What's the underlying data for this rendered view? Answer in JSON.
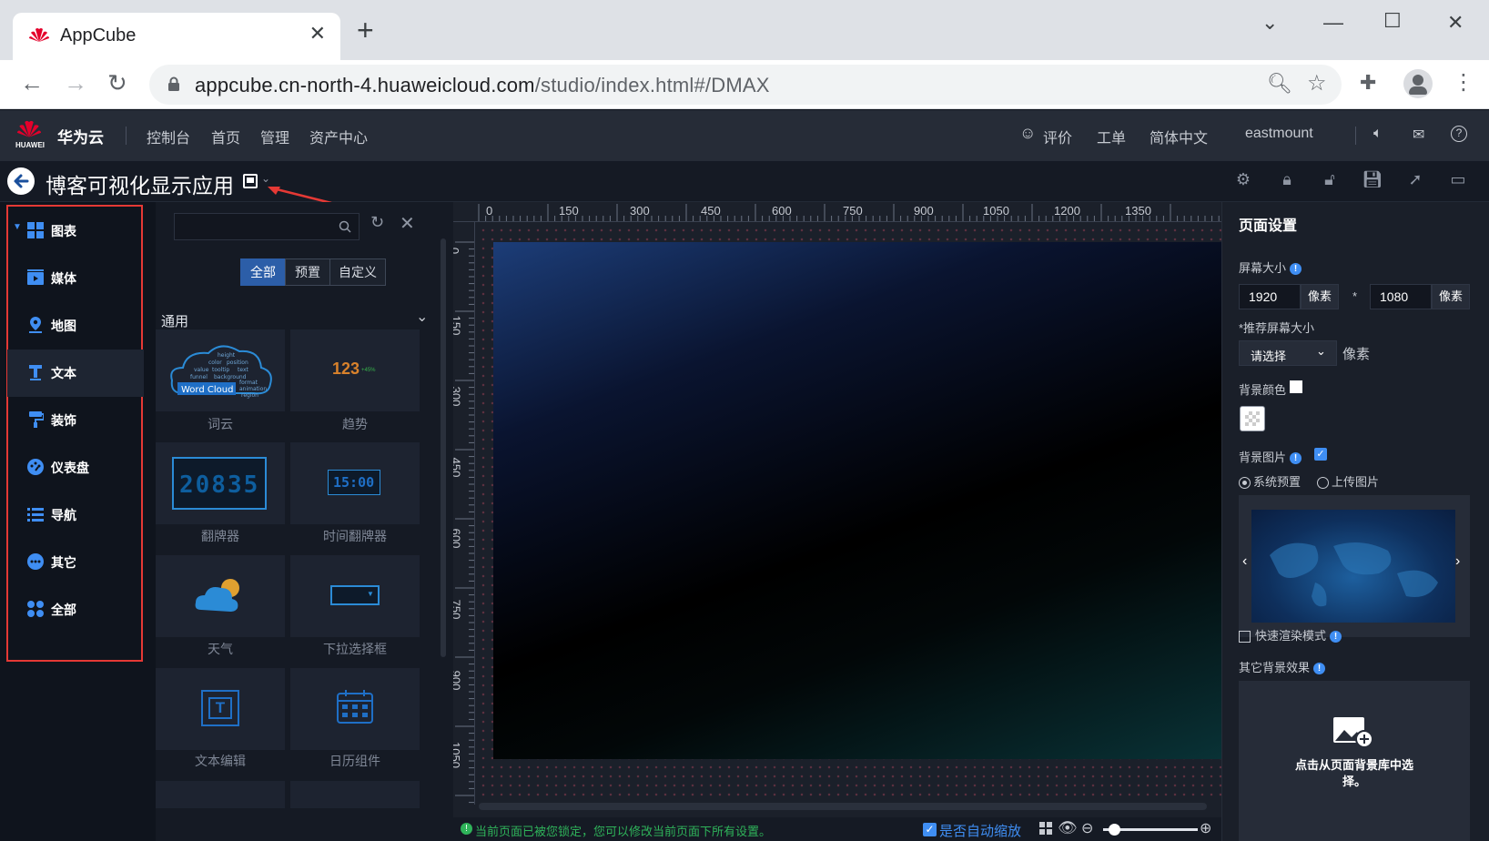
{
  "browser": {
    "tab_title": "AppCube",
    "tab_close": "✕",
    "new_tab": "+",
    "url_host": "appcube.cn-north-4.huaweicloud.com",
    "url_path": "/studio/index.html#/DMAX"
  },
  "header": {
    "brand": "华为云",
    "brand_small": "HUAWEI",
    "links": [
      "控制台",
      "首页",
      "管理",
      "资产中心"
    ],
    "rate": "评价",
    "ticket": "工单",
    "language": "简体中文",
    "user": "eastmount"
  },
  "titlebar": {
    "app_title": "博客可视化显示应用"
  },
  "sidebar": {
    "items": [
      {
        "label": "图表",
        "icon": "grid-icon"
      },
      {
        "label": "媒体",
        "icon": "video-icon"
      },
      {
        "label": "地图",
        "icon": "map-pin-icon"
      },
      {
        "label": "文本",
        "icon": "text-icon"
      },
      {
        "label": "装饰",
        "icon": "paint-roller-icon"
      },
      {
        "label": "仪表盘",
        "icon": "dashboard-icon"
      },
      {
        "label": "导航",
        "icon": "list-icon"
      },
      {
        "label": "其它",
        "icon": "more-icon"
      },
      {
        "label": "全部",
        "icon": "apps-icon"
      }
    ]
  },
  "components": {
    "filters": [
      "全部",
      "预置",
      "自定义"
    ],
    "group": "通用",
    "items": [
      {
        "label": "词云",
        "preview": "Word Cloud"
      },
      {
        "label": "趋势",
        "preview": "123"
      },
      {
        "label": "翻牌器",
        "preview": "20835"
      },
      {
        "label": "时间翻牌器",
        "preview": "15:00"
      },
      {
        "label": "天气",
        "preview": ""
      },
      {
        "label": "下拉选择框",
        "preview": ""
      },
      {
        "label": "文本编辑",
        "preview": "T"
      },
      {
        "label": "日历组件",
        "preview": ""
      }
    ],
    "trend_delta": "+45%",
    "wordcloud_words": [
      "height",
      "color",
      "position",
      "value",
      "tooltip",
      "text",
      "funnel",
      "background",
      "format",
      "animation",
      "region"
    ]
  },
  "canvas": {
    "h_ticks": [
      "0",
      "150",
      "300",
      "450",
      "600",
      "750",
      "900",
      "1050",
      "1200",
      "1350"
    ],
    "v_ticks": [
      "0",
      "150",
      "300",
      "450",
      "600",
      "750",
      "900",
      "1050"
    ],
    "status_message": "当前页面已被您锁定，您可以修改当前页面下所有设置。",
    "auto_scale_label": "是否自动缩放",
    "auto_scale": true
  },
  "page_settings": {
    "title": "页面设置",
    "screen_size_label": "屏幕大小",
    "width": "1920",
    "height": "1080",
    "unit": "像素",
    "times": "*",
    "recommended_label": "*推荐屏幕大小",
    "recommended_placeholder": "请选择",
    "recommended_unit": "像素",
    "bg_color_label": "背景颜色",
    "bg_image_label": "背景图片",
    "bg_image_enabled": true,
    "radio_system": "系统预置",
    "radio_upload": "上传图片",
    "fast_render_label": "快速渲染模式",
    "other_effects_label": "其它背景效果",
    "upload_hint": "点击从页面背景库中选择。"
  },
  "colors": {
    "accent": "#3f8ef3",
    "highlight_box": "#e53935",
    "status_ok": "#2fb35a"
  }
}
